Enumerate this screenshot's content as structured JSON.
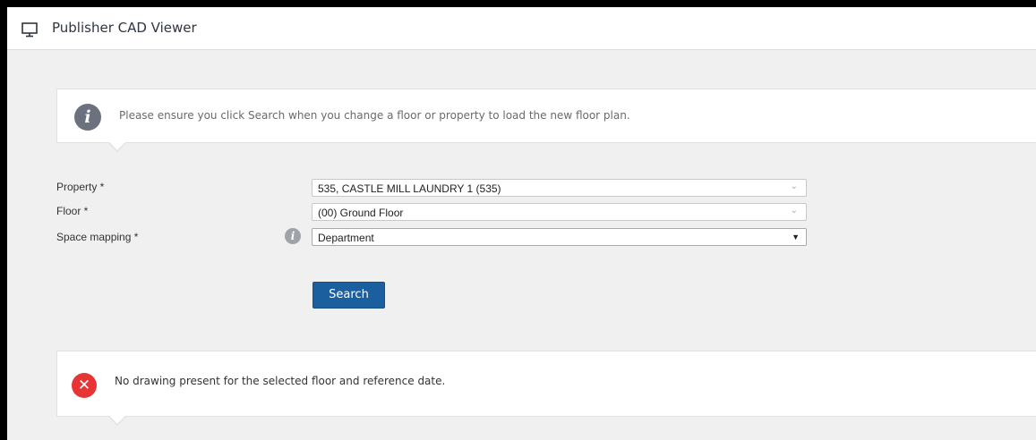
{
  "header": {
    "title": "Publisher CAD Viewer",
    "icon": "monitor-icon"
  },
  "info_callout": {
    "icon": "info-icon",
    "text": "Please ensure you click Search when you change a floor or property to load the new floor plan."
  },
  "form": {
    "property": {
      "label": "Property *",
      "value": "535, CASTLE MILL LAUNDRY 1 (535)"
    },
    "floor": {
      "label": "Floor *",
      "value": "(00) Ground Floor"
    },
    "space_mapping": {
      "label": "Space mapping *",
      "value": "Department",
      "help_icon": "info-icon"
    },
    "search_label": "Search"
  },
  "error_callout": {
    "icon": "close-icon",
    "text": "No drawing present for the selected floor and reference date."
  },
  "colors": {
    "primary_button": "#1c5f9e",
    "error": "#e73535",
    "info_icon": "#6b717d",
    "background": "#f0f0f0"
  }
}
